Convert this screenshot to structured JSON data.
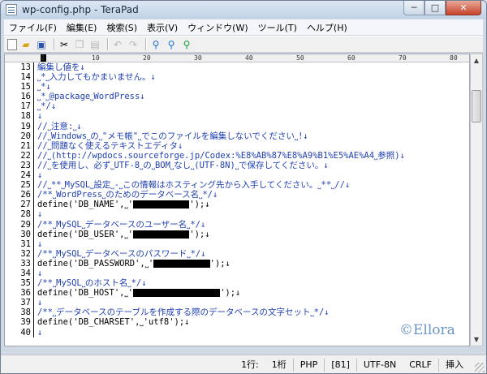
{
  "window": {
    "title": "wp-config.php - TeraPad",
    "min_label": "─",
    "max_label": "□",
    "close_label": "✕"
  },
  "menu": [
    "ファイル(F)",
    "編集(E)",
    "検索(S)",
    "表示(V)",
    "ウィンドウ(W)",
    "ツール(T)",
    "ヘルプ(H)"
  ],
  "toolbar": {
    "icons": [
      "new-file-icon",
      "open-folder-icon",
      "save-icon",
      "cut-icon",
      "copy-icon",
      "paste-icon",
      "undo-icon",
      "redo-icon",
      "find-icon",
      "find-next-icon",
      "find-prev-icon"
    ]
  },
  "ruler": [
    "0",
    "10",
    "20",
    "30",
    "40",
    "50",
    "60",
    "70",
    "80"
  ],
  "editor": {
    "lines": [
      {
        "n": "13",
        "text": "編集し値を↓",
        "style": "comment"
      },
      {
        "n": "14",
        "text": "˽*˽入力してもかまいません。↓",
        "style": "comment"
      },
      {
        "n": "15",
        "text": "˽*↓",
        "style": "comment"
      },
      {
        "n": "16",
        "text": "˽*˽@package˽WordPress↓",
        "style": "comment"
      },
      {
        "n": "17",
        "text": "˽*/↓",
        "style": "comment"
      },
      {
        "n": "18",
        "text": "↓",
        "style": "comment"
      },
      {
        "n": "19",
        "text": "//˽注意:˽↓",
        "style": "comment"
      },
      {
        "n": "20",
        "text": "//˽Windows˽の˽\"メモ帳\"˽でこのファイルを編集しないでください˽!↓",
        "style": "comment"
      },
      {
        "n": "21",
        "text": "//˽問題なく使えるテキストエディタ↓",
        "style": "comment"
      },
      {
        "n": "22",
        "text": "//˽(http://wpdocs.sourceforge.jp/Codex:%E8%AB%87%E8%A9%B1%E5%AE%A4˽参照)↓",
        "style": "comment"
      },
      {
        "n": "23",
        "text": "//˽を使用し、必ず˽UTF-8˽の˽BOM˽なし˽(UTF-8N)˽で保存してください。↓",
        "style": "comment"
      },
      {
        "n": "24",
        "text": "↓",
        "style": "comment"
      },
      {
        "n": "25",
        "text": "//˽**˽MySQL˽設定˽-˽この情報はホスティング先から入手してください。˽**˽//↓",
        "style": "comment"
      },
      {
        "n": "26",
        "text": "/**˽WordPress˽のためのデータベース名˽*/↓",
        "style": "comment"
      },
      {
        "n": "27",
        "text": "define('DB_NAME',˽'",
        "style": "normal",
        "redact": 11,
        "after": "');↓"
      },
      {
        "n": "28",
        "text": "↓",
        "style": "comment"
      },
      {
        "n": "29",
        "text": "/**˽MySQL˽データベースのユーザー名˽*/↓",
        "style": "comment"
      },
      {
        "n": "30",
        "text": "define('DB_USER',˽'",
        "style": "normal",
        "redact": 11,
        "after": "');↓"
      },
      {
        "n": "31",
        "text": "↓",
        "style": "comment"
      },
      {
        "n": "32",
        "text": "/**˽MySQL˽データベースのパスワード˽*/↓",
        "style": "comment"
      },
      {
        "n": "33",
        "text": "define('DB_PASSWORD',˽'",
        "style": "normal",
        "redact": 11,
        "after": "');↓"
      },
      {
        "n": "34",
        "text": "↓",
        "style": "comment"
      },
      {
        "n": "35",
        "text": "/**˽MySQL˽のホスト名˽*/↓",
        "style": "comment"
      },
      {
        "n": "36",
        "text": "define('DB_HOST',˽'",
        "style": "normal",
        "redact": 17,
        "after": "');↓"
      },
      {
        "n": "37",
        "text": "↓",
        "style": "comment"
      },
      {
        "n": "38",
        "text": "/**˽データベースのテーブルを作成する際のデータベースの文字セット˽*/↓",
        "style": "comment"
      },
      {
        "n": "39",
        "text": "define('DB_CHARSET',˽'utf8');↓",
        "style": "normal"
      },
      {
        "n": "40",
        "text": "↓",
        "style": "comment"
      }
    ]
  },
  "watermark": "©Ellora",
  "status": {
    "line": "1行:",
    "col": "1桁",
    "lang": "PHP",
    "char": "[81]",
    "encoding": "UTF-8N",
    "newline": "CRLF",
    "mode": "挿入"
  }
}
